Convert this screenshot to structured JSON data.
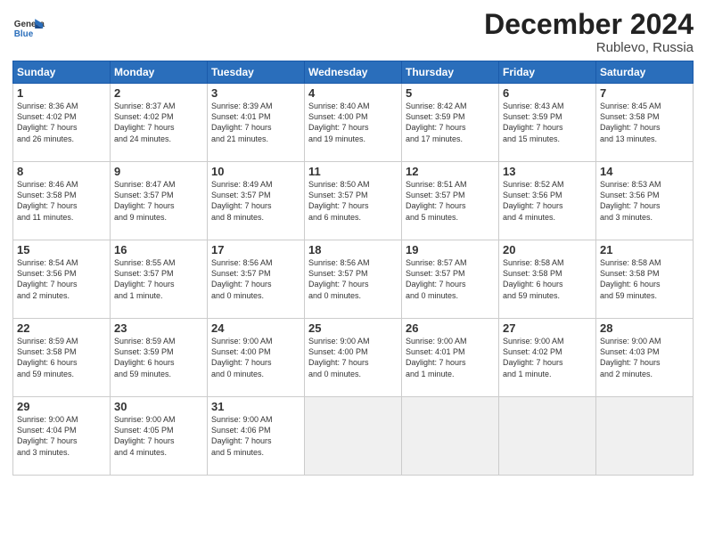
{
  "logo": {
    "general": "General",
    "blue": "Blue"
  },
  "title": "December 2024",
  "subtitle": "Rublevo, Russia",
  "weekdays": [
    "Sunday",
    "Monday",
    "Tuesday",
    "Wednesday",
    "Thursday",
    "Friday",
    "Saturday"
  ],
  "weeks": [
    [
      {
        "day": "1",
        "info": "Sunrise: 8:36 AM\nSunset: 4:02 PM\nDaylight: 7 hours\nand 26 minutes."
      },
      {
        "day": "2",
        "info": "Sunrise: 8:37 AM\nSunset: 4:02 PM\nDaylight: 7 hours\nand 24 minutes."
      },
      {
        "day": "3",
        "info": "Sunrise: 8:39 AM\nSunset: 4:01 PM\nDaylight: 7 hours\nand 21 minutes."
      },
      {
        "day": "4",
        "info": "Sunrise: 8:40 AM\nSunset: 4:00 PM\nDaylight: 7 hours\nand 19 minutes."
      },
      {
        "day": "5",
        "info": "Sunrise: 8:42 AM\nSunset: 3:59 PM\nDaylight: 7 hours\nand 17 minutes."
      },
      {
        "day": "6",
        "info": "Sunrise: 8:43 AM\nSunset: 3:59 PM\nDaylight: 7 hours\nand 15 minutes."
      },
      {
        "day": "7",
        "info": "Sunrise: 8:45 AM\nSunset: 3:58 PM\nDaylight: 7 hours\nand 13 minutes."
      }
    ],
    [
      {
        "day": "8",
        "info": "Sunrise: 8:46 AM\nSunset: 3:58 PM\nDaylight: 7 hours\nand 11 minutes."
      },
      {
        "day": "9",
        "info": "Sunrise: 8:47 AM\nSunset: 3:57 PM\nDaylight: 7 hours\nand 9 minutes."
      },
      {
        "day": "10",
        "info": "Sunrise: 8:49 AM\nSunset: 3:57 PM\nDaylight: 7 hours\nand 8 minutes."
      },
      {
        "day": "11",
        "info": "Sunrise: 8:50 AM\nSunset: 3:57 PM\nDaylight: 7 hours\nand 6 minutes."
      },
      {
        "day": "12",
        "info": "Sunrise: 8:51 AM\nSunset: 3:57 PM\nDaylight: 7 hours\nand 5 minutes."
      },
      {
        "day": "13",
        "info": "Sunrise: 8:52 AM\nSunset: 3:56 PM\nDaylight: 7 hours\nand 4 minutes."
      },
      {
        "day": "14",
        "info": "Sunrise: 8:53 AM\nSunset: 3:56 PM\nDaylight: 7 hours\nand 3 minutes."
      }
    ],
    [
      {
        "day": "15",
        "info": "Sunrise: 8:54 AM\nSunset: 3:56 PM\nDaylight: 7 hours\nand 2 minutes."
      },
      {
        "day": "16",
        "info": "Sunrise: 8:55 AM\nSunset: 3:57 PM\nDaylight: 7 hours\nand 1 minute."
      },
      {
        "day": "17",
        "info": "Sunrise: 8:56 AM\nSunset: 3:57 PM\nDaylight: 7 hours\nand 0 minutes."
      },
      {
        "day": "18",
        "info": "Sunrise: 8:56 AM\nSunset: 3:57 PM\nDaylight: 7 hours\nand 0 minutes."
      },
      {
        "day": "19",
        "info": "Sunrise: 8:57 AM\nSunset: 3:57 PM\nDaylight: 7 hours\nand 0 minutes."
      },
      {
        "day": "20",
        "info": "Sunrise: 8:58 AM\nSunset: 3:58 PM\nDaylight: 6 hours\nand 59 minutes."
      },
      {
        "day": "21",
        "info": "Sunrise: 8:58 AM\nSunset: 3:58 PM\nDaylight: 6 hours\nand 59 minutes."
      }
    ],
    [
      {
        "day": "22",
        "info": "Sunrise: 8:59 AM\nSunset: 3:58 PM\nDaylight: 6 hours\nand 59 minutes."
      },
      {
        "day": "23",
        "info": "Sunrise: 8:59 AM\nSunset: 3:59 PM\nDaylight: 6 hours\nand 59 minutes."
      },
      {
        "day": "24",
        "info": "Sunrise: 9:00 AM\nSunset: 4:00 PM\nDaylight: 7 hours\nand 0 minutes."
      },
      {
        "day": "25",
        "info": "Sunrise: 9:00 AM\nSunset: 4:00 PM\nDaylight: 7 hours\nand 0 minutes."
      },
      {
        "day": "26",
        "info": "Sunrise: 9:00 AM\nSunset: 4:01 PM\nDaylight: 7 hours\nand 1 minute."
      },
      {
        "day": "27",
        "info": "Sunrise: 9:00 AM\nSunset: 4:02 PM\nDaylight: 7 hours\nand 1 minute."
      },
      {
        "day": "28",
        "info": "Sunrise: 9:00 AM\nSunset: 4:03 PM\nDaylight: 7 hours\nand 2 minutes."
      }
    ],
    [
      {
        "day": "29",
        "info": "Sunrise: 9:00 AM\nSunset: 4:04 PM\nDaylight: 7 hours\nand 3 minutes."
      },
      {
        "day": "30",
        "info": "Sunrise: 9:00 AM\nSunset: 4:05 PM\nDaylight: 7 hours\nand 4 minutes."
      },
      {
        "day": "31",
        "info": "Sunrise: 9:00 AM\nSunset: 4:06 PM\nDaylight: 7 hours\nand 5 minutes."
      },
      null,
      null,
      null,
      null
    ]
  ]
}
